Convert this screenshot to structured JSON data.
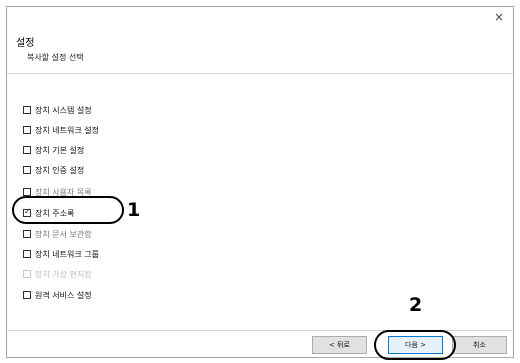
{
  "window": {
    "title": "",
    "close_glyph": "×"
  },
  "header": {
    "title": "설정",
    "subtitle": "복사할 설정 선택"
  },
  "options": [
    {
      "label": "장치 시스템 설정",
      "checked": false,
      "enabled": true
    },
    {
      "label": "장치 네트워크 설정",
      "checked": false,
      "enabled": true
    },
    {
      "label": "장치 기본 설정",
      "checked": false,
      "enabled": true
    },
    {
      "label": "장치 인증 설정",
      "checked": false,
      "enabled": true
    },
    {
      "label": "장치 사용자 목록",
      "checked": false,
      "enabled": true
    },
    {
      "label": "장치 주소록",
      "checked": true,
      "enabled": true
    },
    {
      "label": "장치 문서 보관함",
      "checked": false,
      "enabled": true
    },
    {
      "label": "장치 네트워크 그룹",
      "checked": false,
      "enabled": true
    },
    {
      "label": "장치 가상 편지함",
      "checked": false,
      "enabled": false
    },
    {
      "label": "원격 서비스 설정",
      "checked": false,
      "enabled": true
    }
  ],
  "annotations": {
    "step1": "1",
    "step2": "2"
  },
  "footer": {
    "back_label": "< 뒤로",
    "next_label": "다음 >",
    "cancel_label": "취소"
  },
  "icons": {
    "checkbox_check": "check-icon",
    "close": "close-icon"
  }
}
